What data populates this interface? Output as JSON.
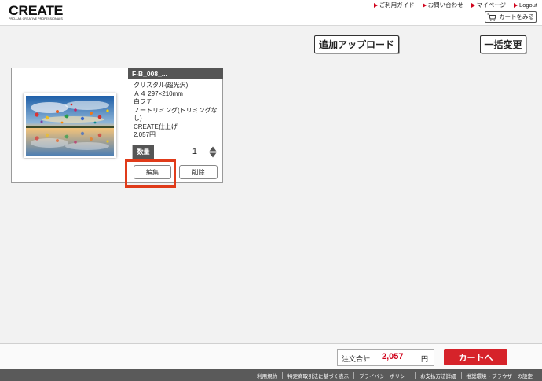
{
  "header": {
    "logo_text": "CREATE",
    "logo_subtext": "PRO-LAB CREATIVE PROFESSIONALS",
    "nav": [
      "ご利用ガイド",
      "お問い合わせ",
      "マイページ",
      "Logout"
    ],
    "cart_view_label": "カートをみる"
  },
  "toolbar": {
    "upload_label": "追加アップロード",
    "bulk_change_label": "一括変更"
  },
  "item": {
    "title": "F-B_008_...",
    "details": [
      "クリスタル(超光沢)",
      "Ａ４ 297×210mm",
      "白フチ",
      "ノートリミング(トリミングなし)",
      "CREATE仕上げ",
      "2,057円"
    ],
    "quantity_label": "数量",
    "quantity": "1",
    "edit_label": "編集",
    "delete_label": "削除"
  },
  "summary": {
    "total_label": "注文合計",
    "total_value": "2,057",
    "total_unit": "円",
    "cart_button": "カートへ"
  },
  "footer": {
    "links": [
      "利用規約",
      "特定商取引法に基づく表示",
      "プライバシーポリシー",
      "お支払方法詳細",
      "推奨環境・ブラウザーの設定"
    ]
  },
  "colors": {
    "accent_red": "#d6232a",
    "highlight_orange": "#e03b1a",
    "title_bar_gray": "#555555",
    "footer_gray": "#5a5a5a"
  }
}
